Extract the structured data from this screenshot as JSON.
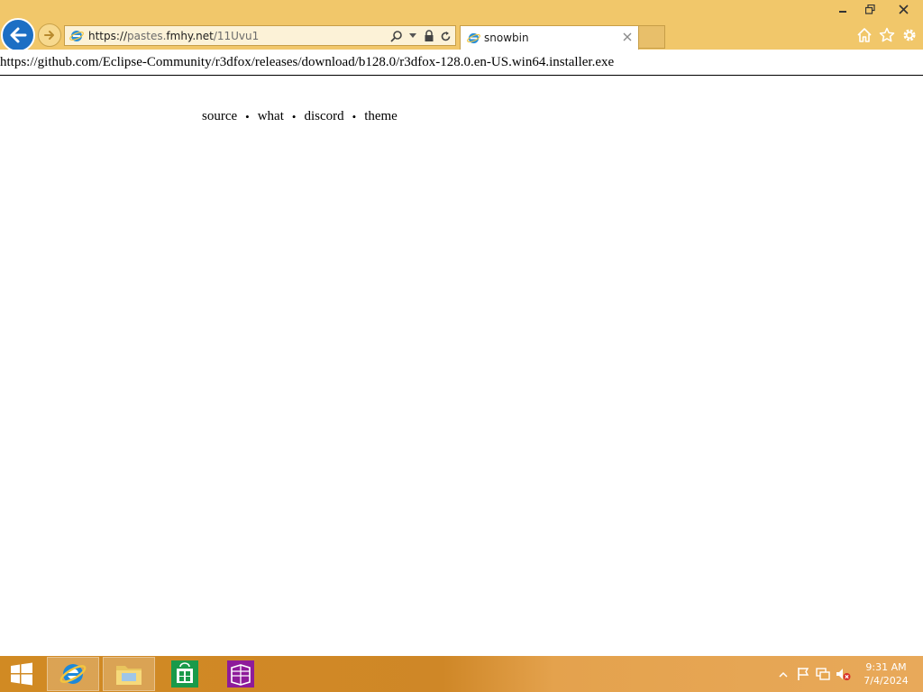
{
  "browser": {
    "address_url_prefix": "https://",
    "address_url_host_dim": "pastes.",
    "address_url_host": "fmhy.net",
    "address_url_path": "/11Uvu1",
    "tab_title": "snowbin",
    "accent_color": "#f1c76a"
  },
  "page": {
    "download_url": "https://github.com/Eclipse-Community/r3dfox/releases/download/b128.0/r3dfox-128.0.en-US.win64.installer.exe",
    "nav": {
      "source": "source",
      "what": "what",
      "discord": "discord",
      "theme": "theme",
      "separator": "•"
    }
  },
  "taskbar": {
    "clock_time": "9:31 AM",
    "clock_date": "7/4/2024",
    "pinned_apps": [
      "internet-explorer",
      "file-explorer",
      "windows-store",
      "onenote-app"
    ]
  },
  "icons": {
    "back": "back-arrow-icon",
    "forward": "forward-arrow-icon",
    "search": "search-icon",
    "lock": "lock-icon",
    "refresh": "refresh-icon",
    "home": "home-icon",
    "favorites": "star-icon",
    "tools": "gear-icon"
  }
}
